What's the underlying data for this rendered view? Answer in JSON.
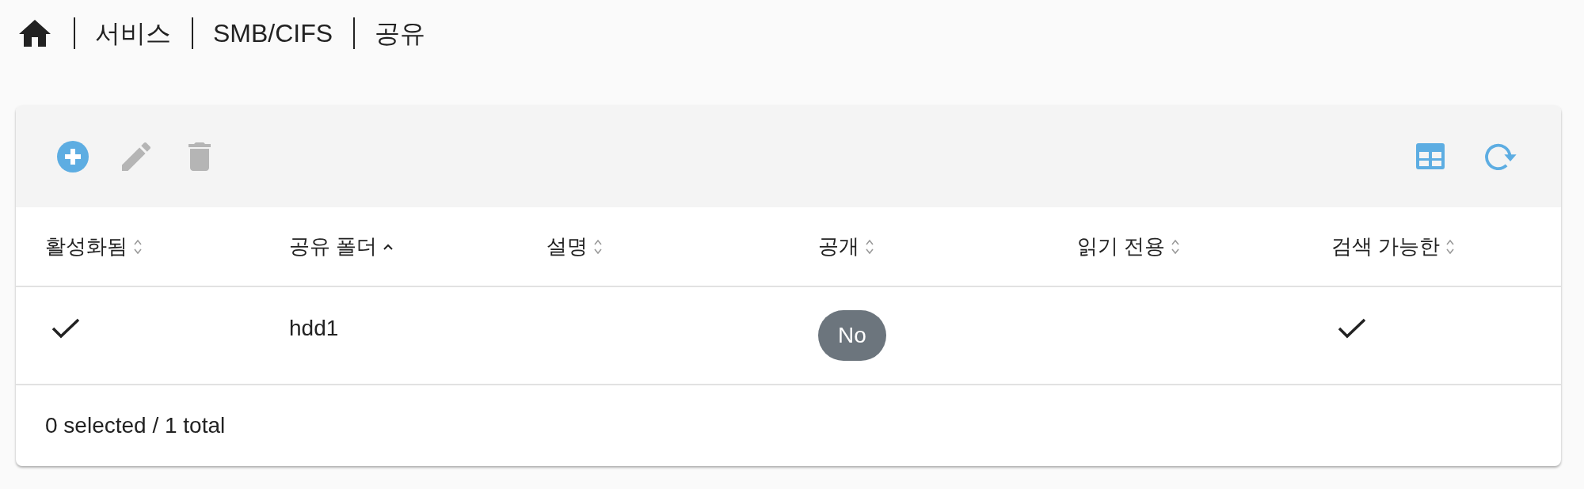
{
  "breadcrumb": {
    "items": [
      {
        "text": "서비스"
      },
      {
        "text": "SMB/CIFS"
      },
      {
        "text": "공유"
      }
    ]
  },
  "toolbar": {
    "left": [
      {
        "kind": "add",
        "disabled": false
      },
      {
        "kind": "edit",
        "disabled": true
      },
      {
        "kind": "delete",
        "disabled": true
      }
    ],
    "right": [
      {
        "kind": "columns",
        "disabled": false
      },
      {
        "kind": "refresh",
        "disabled": false
      }
    ]
  },
  "table": {
    "columns": [
      {
        "label": "활성화됨",
        "sorted": false
      },
      {
        "label": "공유 폴더",
        "sorted": true
      },
      {
        "label": "설명",
        "sorted": false
      },
      {
        "label": "공개",
        "sorted": false
      },
      {
        "label": "읽기 전용",
        "sorted": false
      },
      {
        "label": "검색 가능한",
        "sorted": false
      }
    ],
    "rows": [
      {
        "cells": [
          {
            "kind": "check",
            "checked": true
          },
          {
            "kind": "text",
            "text": "hdd1"
          },
          {
            "kind": "blank"
          },
          {
            "kind": "badge",
            "text": "No"
          },
          {
            "kind": "check",
            "checked": false
          },
          {
            "kind": "check",
            "checked": true
          }
        ]
      }
    ]
  },
  "footer": {
    "summary": "0 selected / 1 total"
  }
}
